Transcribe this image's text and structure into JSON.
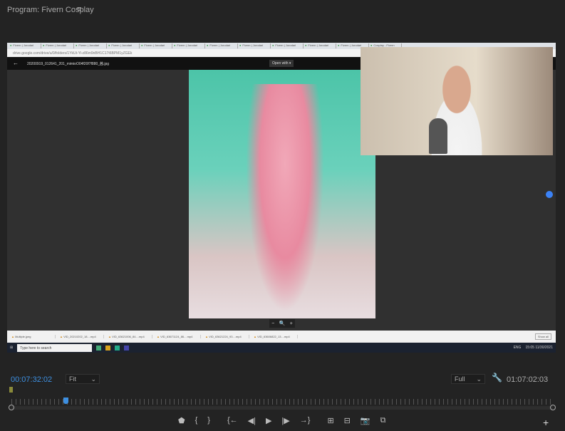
{
  "panel": {
    "title": "Program: Fivern Cosplay",
    "menu_icon": "hamburger-icon"
  },
  "browser": {
    "tabs": [
      "Fivern | Jorodari",
      "Fivern | Jorodari",
      "Fivern | Jorodari",
      "Fivern | Jorodari",
      "Fivern | Jorodari",
      "Fivern | Jorodari",
      "Fivern | Jorodari",
      "Fivern | Jorodari",
      "Fivern | Jorodari",
      "Fivern | Jorodari",
      "Fivern | Jorodari",
      "Cosplay - Fivern"
    ],
    "url": "drive.google.com/drive/u/0/folders/1YkUt-Yi-z86m9nBH1C17t6BPM1yZGEk",
    "file_name": "20200919_012641_201_mimioO04f20f7f880_茜.jpg",
    "open_with": "Open with ▾",
    "zoom_controls": [
      "−",
      "🔍",
      "+"
    ]
  },
  "downloads": {
    "items": [
      "Multiple.jpeg",
      "VID_20210202_18....mp4",
      "VID_63621006_84....mp4",
      "VID_63671124_86....mp4",
      "VID_63621224_93....mp4",
      "VID_63606822_13....mp4"
    ],
    "show_all": "Show all"
  },
  "taskbar": {
    "search_placeholder": "Type here to search",
    "clock": "15:05 11/30/2021",
    "lang": "ENG"
  },
  "monitor": {
    "timecode_current": "00:07:32:02",
    "zoom": "Fit",
    "resolution": "Full",
    "timecode_duration": "01:07:02:03",
    "playhead_fraction": 0.1,
    "controls": [
      {
        "name": "add-marker-button",
        "glyph": "⬟"
      },
      {
        "name": "mark-in-button",
        "glyph": "{"
      },
      {
        "name": "mark-out-button",
        "glyph": "}"
      },
      {
        "name": "go-to-in-button",
        "glyph": "{←"
      },
      {
        "name": "step-back-button",
        "glyph": "◀|"
      },
      {
        "name": "play-button",
        "glyph": "▶"
      },
      {
        "name": "step-forward-button",
        "glyph": "|▶"
      },
      {
        "name": "go-to-out-button",
        "glyph": "→}"
      },
      {
        "name": "insert-button",
        "glyph": "⊞"
      },
      {
        "name": "overwrite-button",
        "glyph": "⊟"
      },
      {
        "name": "export-frame-button",
        "glyph": "📷"
      },
      {
        "name": "compare-view-button",
        "glyph": "⧉"
      }
    ],
    "add_button": "+"
  }
}
